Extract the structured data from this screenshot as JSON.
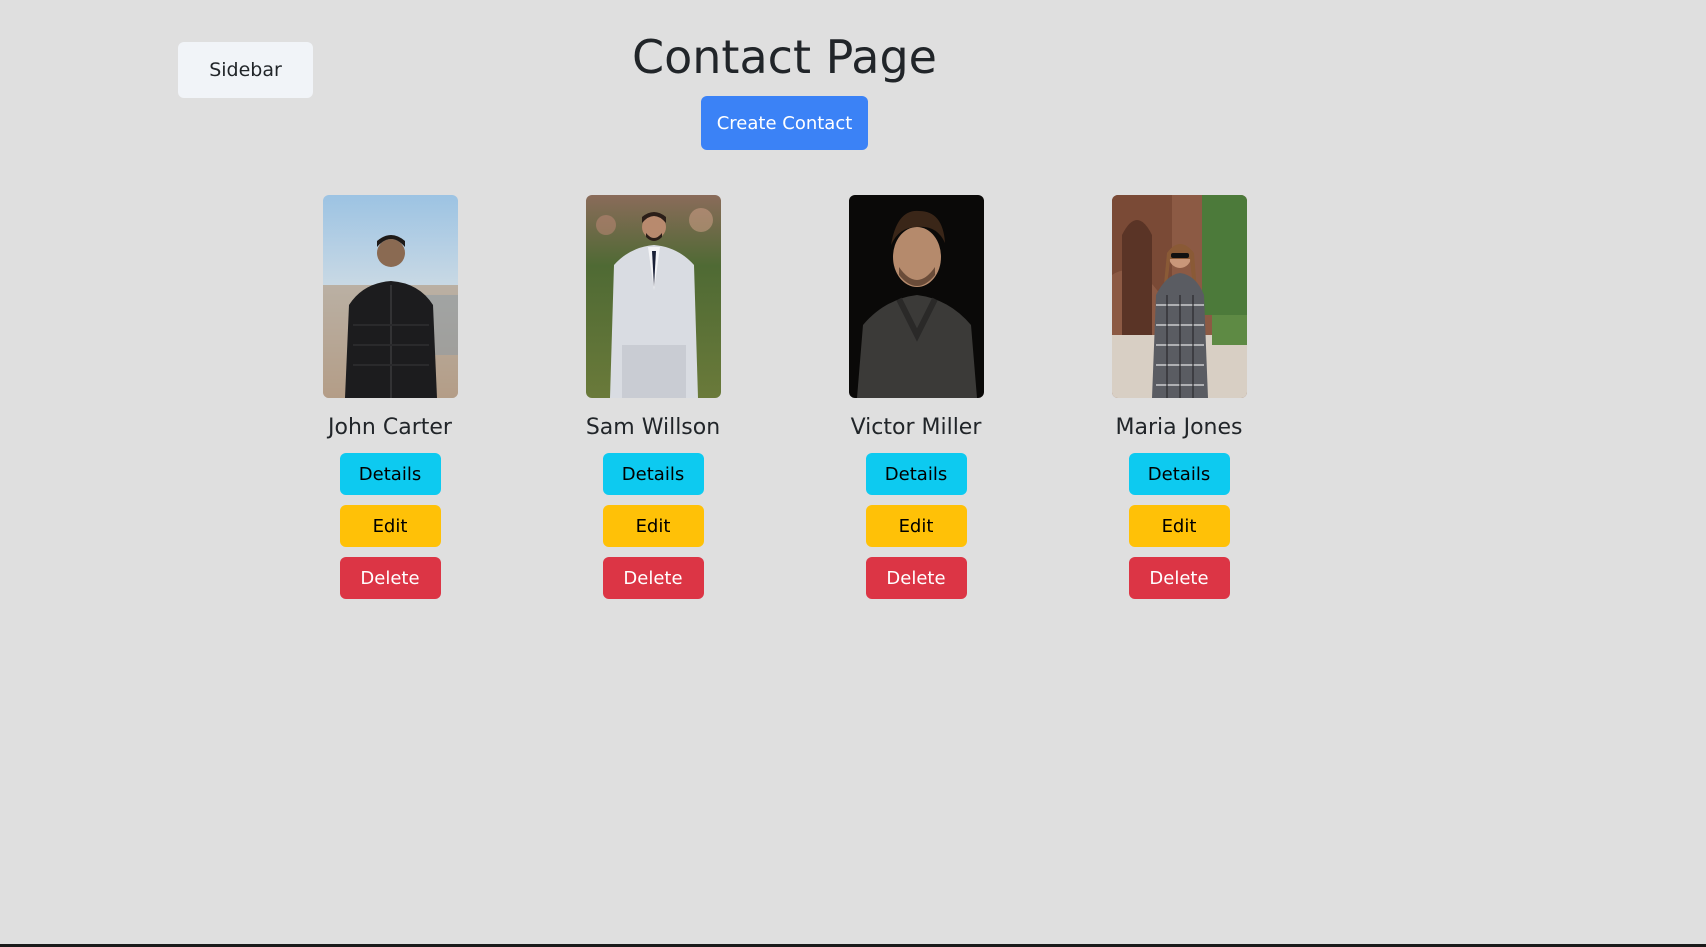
{
  "sidebar": {
    "label": "Sidebar"
  },
  "header": {
    "title": "Contact Page",
    "create_label": "Create Contact"
  },
  "contacts": [
    {
      "name": "John Carter",
      "details_label": "Details",
      "edit_label": "Edit",
      "delete_label": "Delete"
    },
    {
      "name": "Sam Willson",
      "details_label": "Details",
      "edit_label": "Edit",
      "delete_label": "Delete"
    },
    {
      "name": "Victor Miller",
      "details_label": "Details",
      "edit_label": "Edit",
      "delete_label": "Delete"
    },
    {
      "name": "Maria Jones",
      "details_label": "Details",
      "edit_label": "Edit",
      "delete_label": "Delete"
    }
  ],
  "colors": {
    "background": "#dfdfdf",
    "primary": "#3b82f6",
    "details": "#0dcaf0",
    "edit": "#ffc107",
    "delete": "#dc3545"
  }
}
